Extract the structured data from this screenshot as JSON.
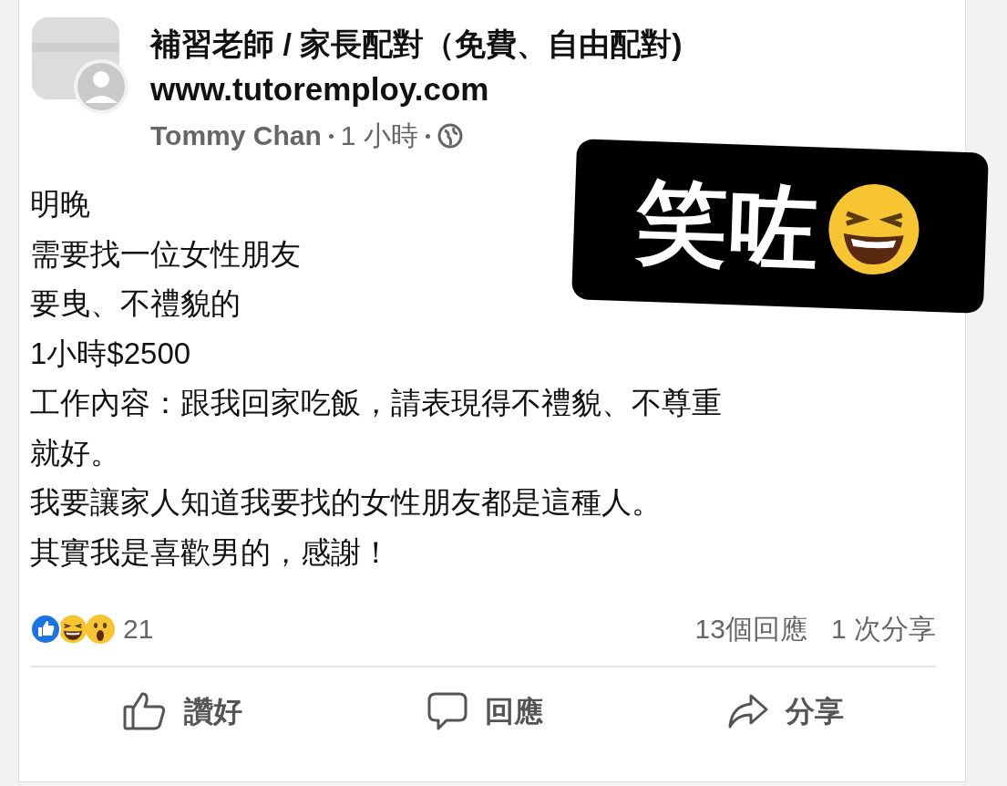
{
  "post": {
    "group_name": "補習老師 / 家長配對（免費、自由配對)",
    "group_url": "www.tutoremploy.com",
    "author": "Tommy Chan",
    "time": "1 小時",
    "body_lines": [
      "明晚",
      "需要找一位女性朋友",
      "要曳、不禮貌的",
      "1小時$2500",
      "工作內容：跟我回家吃飯，請表現得不禮貌、不尊重",
      "就好。",
      "我要讓家人知道我要找的女性朋友都是這種人。",
      "其實我是喜歡男的，感謝！"
    ],
    "reaction_count": "21",
    "comments": "13個回應",
    "shares": "1 次分享",
    "actions": [
      {
        "kind": "like",
        "label": "讚好"
      },
      {
        "kind": "comment",
        "label": "回應"
      },
      {
        "kind": "share",
        "label": "分享"
      }
    ]
  },
  "sticker": {
    "text": "笑咗"
  }
}
